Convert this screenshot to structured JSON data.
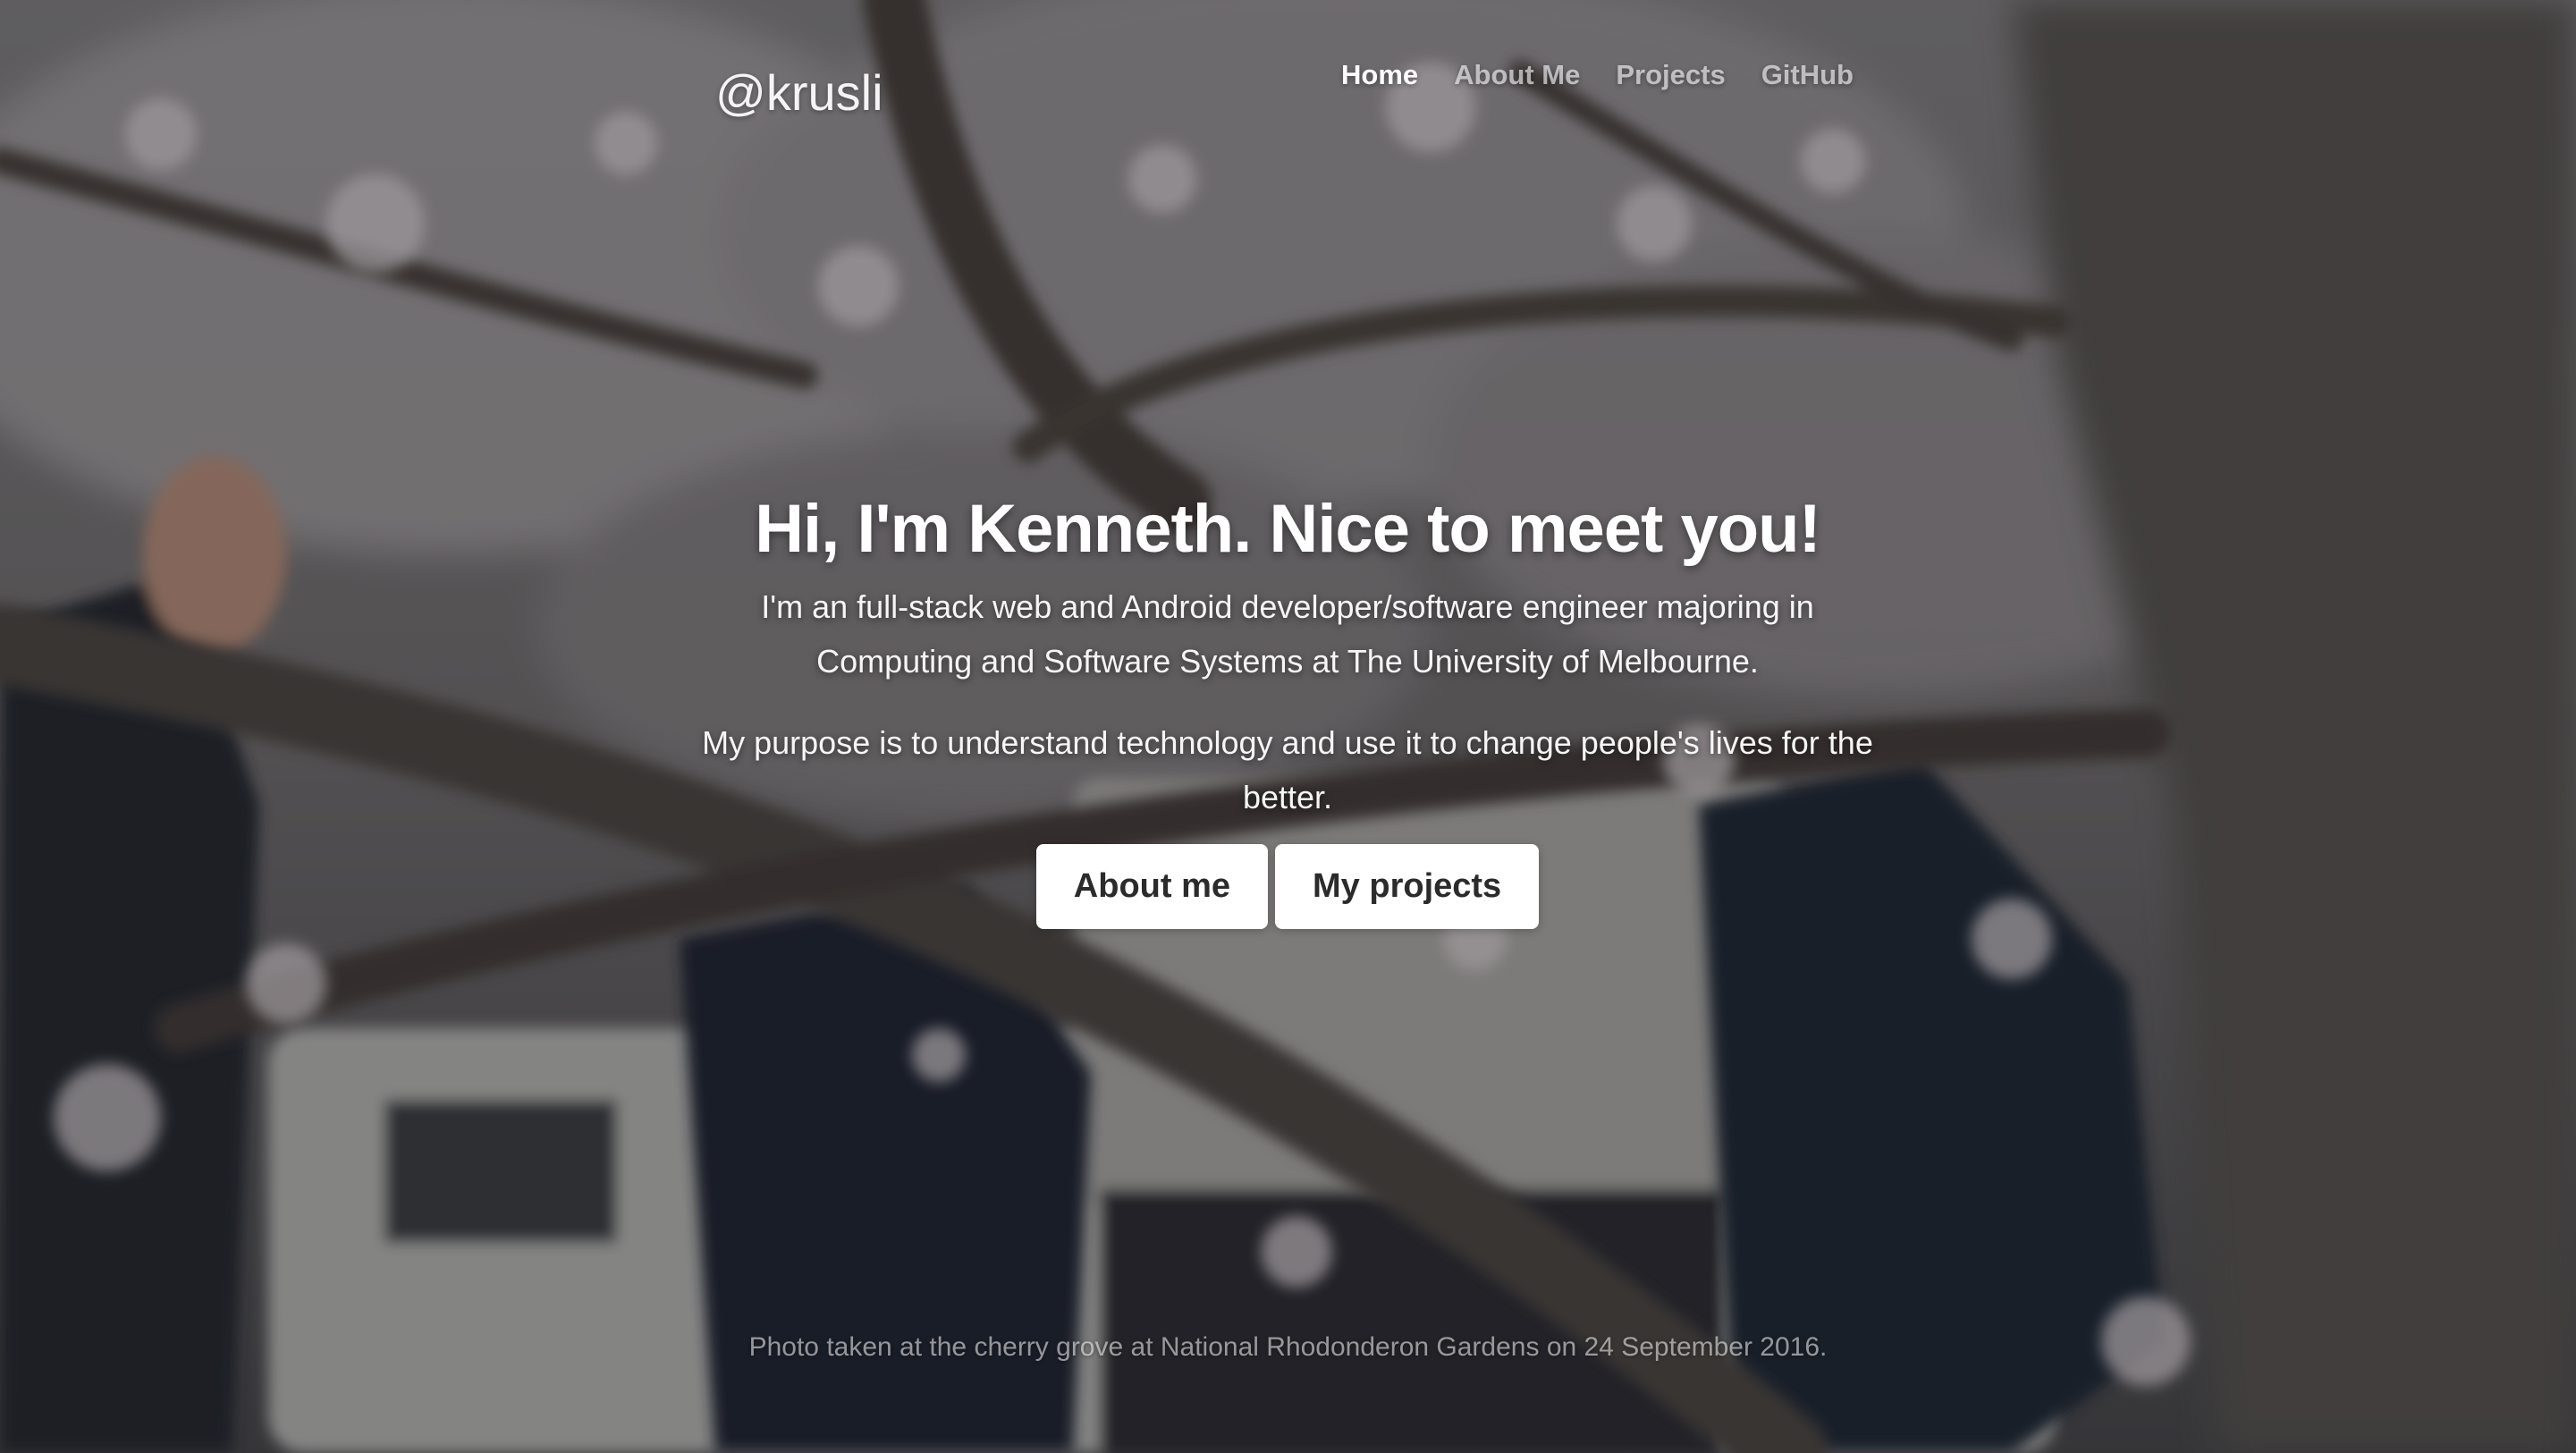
{
  "header": {
    "brand": "@krusli",
    "nav": [
      {
        "label": "Home",
        "active": true
      },
      {
        "label": "About Me",
        "active": false
      },
      {
        "label": "Projects",
        "active": false
      },
      {
        "label": "GitHub",
        "active": false
      }
    ]
  },
  "hero": {
    "title": "Hi, I'm Kenneth. Nice to meet you!",
    "paragraph1": "I'm an full-stack web and Android developer/software engineer majoring in Computing and Software Systems at The University of Melbourne.",
    "paragraph2": "My purpose is to understand technology and use it to change people's lives for the better.",
    "buttons": {
      "about": "About me",
      "projects": "My projects"
    }
  },
  "footer": {
    "caption": "Photo taken at the cherry grove at National Rhodonderon Gardens on 24 September 2016."
  },
  "colors": {
    "button_bg": "#ffffff",
    "button_text": "#2b2b2b",
    "nav_active": "#ffffff",
    "nav_inactive": "rgba(255,255,255,0.62)"
  }
}
